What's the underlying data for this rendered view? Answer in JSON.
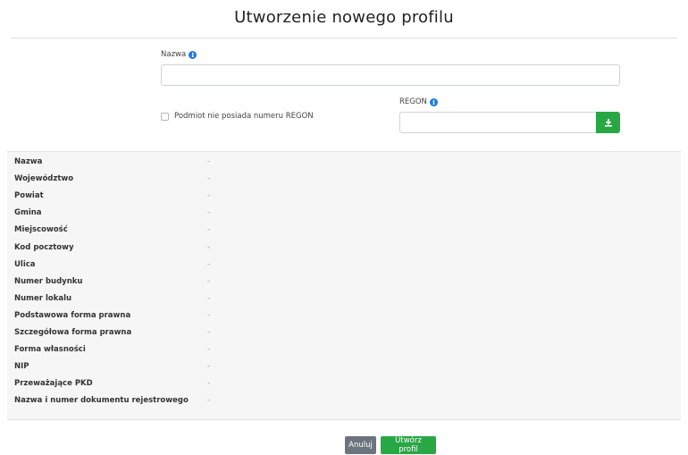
{
  "page": {
    "title": "Utworzenie nowego profilu"
  },
  "form": {
    "name_label": "Nazwa",
    "name_value": "",
    "regon_label": "REGON",
    "regon_value": "",
    "no_regon_label": "Podmiot nie posiada numeru REGON",
    "no_regon_checked": false
  },
  "details": [
    {
      "label": "Nazwa",
      "value": "-"
    },
    {
      "label": "Województwo",
      "value": "-"
    },
    {
      "label": "Powiat",
      "value": "-"
    },
    {
      "label": "Gmina",
      "value": "-"
    },
    {
      "label": "Miejscowość",
      "value": "-"
    },
    {
      "label": "Kod pocztowy",
      "value": "-"
    },
    {
      "label": "Ulica",
      "value": "-"
    },
    {
      "label": "Numer budynku",
      "value": "-"
    },
    {
      "label": "Numer lokalu",
      "value": "-"
    },
    {
      "label": "Podstawowa forma prawna",
      "value": "-"
    },
    {
      "label": "Szczegółowa forma prawna",
      "value": "-"
    },
    {
      "label": "Forma własności",
      "value": "-"
    },
    {
      "label": "NIP",
      "value": "-"
    },
    {
      "label": "Przeważające PKD",
      "value": "-"
    },
    {
      "label": "Nazwa i numer dokumentu rejestrowego",
      "value": "-"
    }
  ],
  "buttons": {
    "cancel": "Anuluj",
    "create": "Utwórz profil"
  },
  "icons": {
    "info": "info-icon",
    "download": "download-icon"
  },
  "colors": {
    "primary": "#1f7ae0",
    "success": "#28a745",
    "secondary": "#6c757d"
  }
}
